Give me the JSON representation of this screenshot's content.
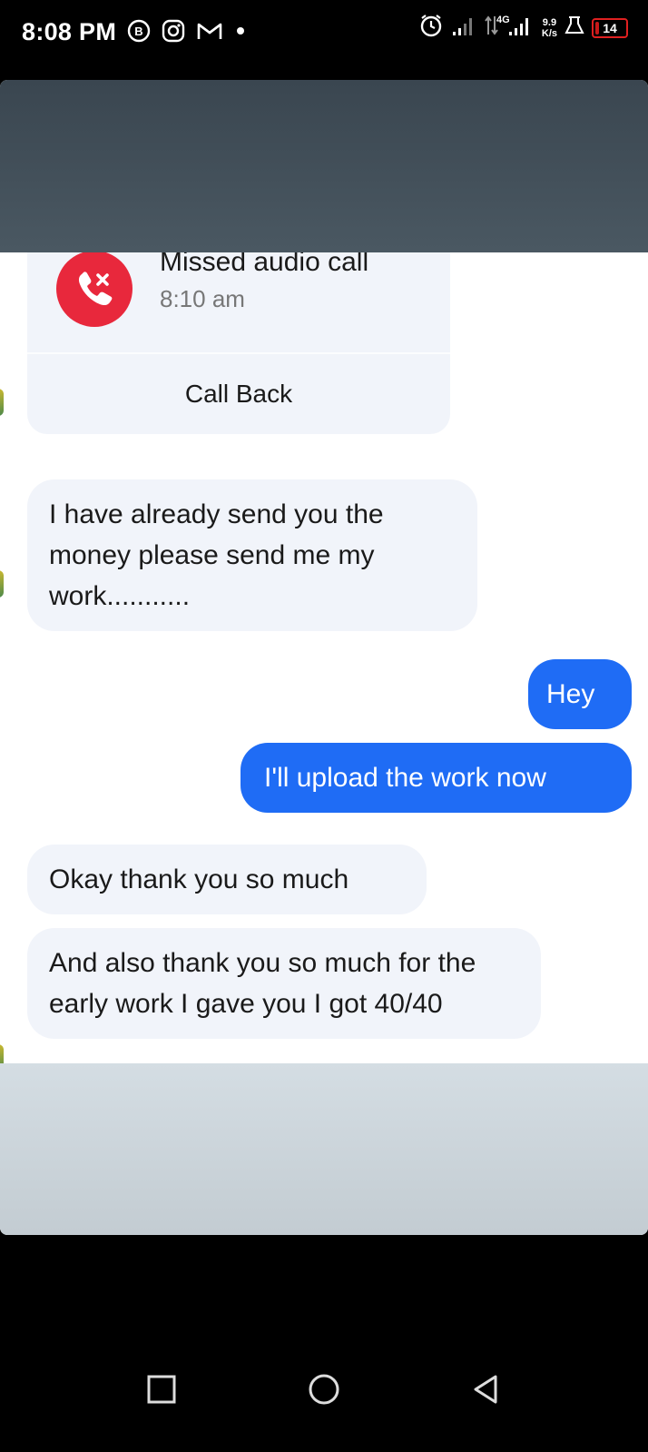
{
  "status_bar": {
    "time": "8:08 PM",
    "left_icons": [
      "messenger-b-icon",
      "instagram-icon",
      "gmail-icon",
      "dot-icon"
    ],
    "network_generation": "4G",
    "speed_value": "9.9",
    "speed_unit": "K/s",
    "battery_level": "14",
    "battery_fraction": 0.14,
    "battery_color": "#e02020"
  },
  "chat": {
    "missed_call": {
      "title": "Missed audio call",
      "time": "8:10 am",
      "action_label": "Call Back",
      "icon": "missed-call-icon",
      "icon_color": "#e8283c"
    },
    "messages": [
      {
        "direction": "incoming",
        "text": "I have already send you the money please send me my work..........."
      },
      {
        "direction": "outgoing",
        "text": "Hey"
      },
      {
        "direction": "outgoing",
        "text": "I'll upload the work now"
      },
      {
        "direction": "incoming",
        "text": "Okay thank you so much"
      },
      {
        "direction": "incoming",
        "text": "And also thank you so much for the early work I gave you I got 40/40"
      }
    ],
    "colors": {
      "outgoing_bubble": "#1f6cf5",
      "incoming_bubble": "#f1f4fa"
    }
  },
  "nav_bar": {
    "buttons": [
      "recent-apps-icon",
      "home-icon",
      "back-icon"
    ]
  }
}
